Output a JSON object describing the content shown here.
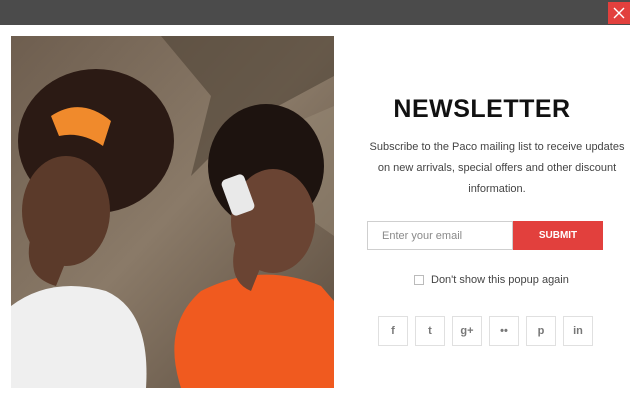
{
  "popup": {
    "title": "NEWSLETTER",
    "description": "Subscribe to the Paco mailing list to receive updates on new arrivals, special offers and other discount information.",
    "email_placeholder": "Enter your email",
    "submit_label": "SUBMIT",
    "checkbox_label": "Don't show this popup again",
    "checkbox_checked": false,
    "social": [
      {
        "icon": "facebook-icon",
        "glyph": "f"
      },
      {
        "icon": "twitter-icon",
        "glyph": "t"
      },
      {
        "icon": "google-plus-icon",
        "glyph": "g+"
      },
      {
        "icon": "flickr-icon",
        "glyph": "••"
      },
      {
        "icon": "pinterest-icon",
        "glyph": "p"
      },
      {
        "icon": "linkedin-icon",
        "glyph": "in"
      }
    ]
  },
  "colors": {
    "accent": "#e2403d",
    "topbar": "#4b4b4b"
  }
}
